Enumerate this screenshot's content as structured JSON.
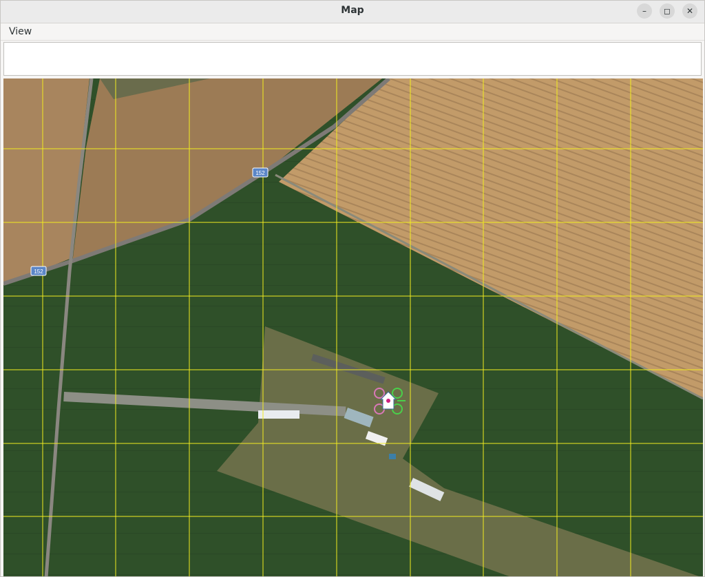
{
  "window": {
    "title": "Map",
    "controls": {
      "minimize": "–",
      "maximize": "◻",
      "close": "✕"
    }
  },
  "menu": {
    "items": [
      {
        "label": "View"
      }
    ]
  },
  "map": {
    "road_shields": [
      {
        "label": "152"
      },
      {
        "label": "152"
      }
    ],
    "grid_color": "#f2ec1f",
    "home_marker": "home-icon"
  },
  "colors": {
    "field_green": "#2f4f2a",
    "wheat": "#c09a6a",
    "airfield": "#6a6f48"
  }
}
